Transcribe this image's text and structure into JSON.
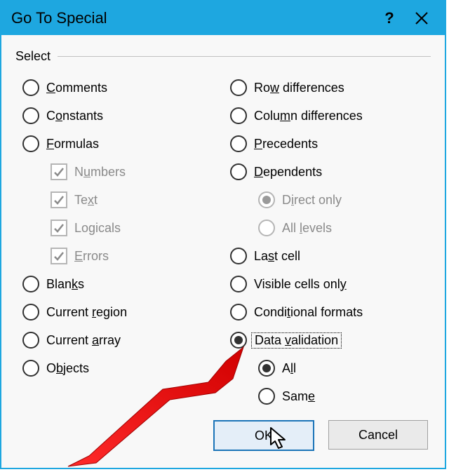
{
  "titlebar": {
    "title": "Go To Special"
  },
  "group": {
    "label": "Select"
  },
  "left": {
    "comments": {
      "pre": "",
      "u": "C",
      "post": "omments"
    },
    "constants": {
      "pre": "C",
      "u": "o",
      "post": "nstants"
    },
    "formulas": {
      "pre": "",
      "u": "F",
      "post": "ormulas"
    },
    "numbers": {
      "pre": "N",
      "u": "u",
      "post": "mbers"
    },
    "text": {
      "pre": "Te",
      "u": "x",
      "post": "t"
    },
    "logicals": {
      "pre": "Lo",
      "u": "g",
      "post": "icals"
    },
    "errors": {
      "pre": "",
      "u": "E",
      "post": "rrors"
    },
    "blanks": {
      "pre": "Blan",
      "u": "k",
      "post": "s"
    },
    "current_region": {
      "pre": "Current ",
      "u": "r",
      "post": "egion"
    },
    "current_array": {
      "pre": "Current ",
      "u": "a",
      "post": "rray"
    },
    "objects": {
      "pre": "O",
      "u": "b",
      "post": "jects"
    }
  },
  "right": {
    "row_diff": {
      "pre": "Ro",
      "u": "w",
      "post": " differences"
    },
    "col_diff": {
      "pre": "Colu",
      "u": "m",
      "post": "n differences"
    },
    "precedents": {
      "pre": "",
      "u": "P",
      "post": "recedents"
    },
    "dependents": {
      "pre": "",
      "u": "D",
      "post": "ependents"
    },
    "direct_only": {
      "pre": "D",
      "u": "i",
      "post": "rect only"
    },
    "all_levels": {
      "pre": "All ",
      "u": "l",
      "post": "evels"
    },
    "last_cell": {
      "pre": "La",
      "u": "s",
      "post": "t cell"
    },
    "visible_cells": {
      "pre": "Visible cells onl",
      "u": "y",
      "post": ""
    },
    "cond_formats": {
      "pre": "Condi",
      "u": "t",
      "post": "ional formats"
    },
    "data_validation": {
      "pre": "Data ",
      "u": "v",
      "post": "alidation"
    },
    "dv_all": {
      "pre": "A",
      "u": "l",
      "post": "l"
    },
    "dv_same": {
      "pre": "Sam",
      "u": "e",
      "post": ""
    }
  },
  "buttons": {
    "ok": "OK",
    "cancel": "Cancel"
  }
}
